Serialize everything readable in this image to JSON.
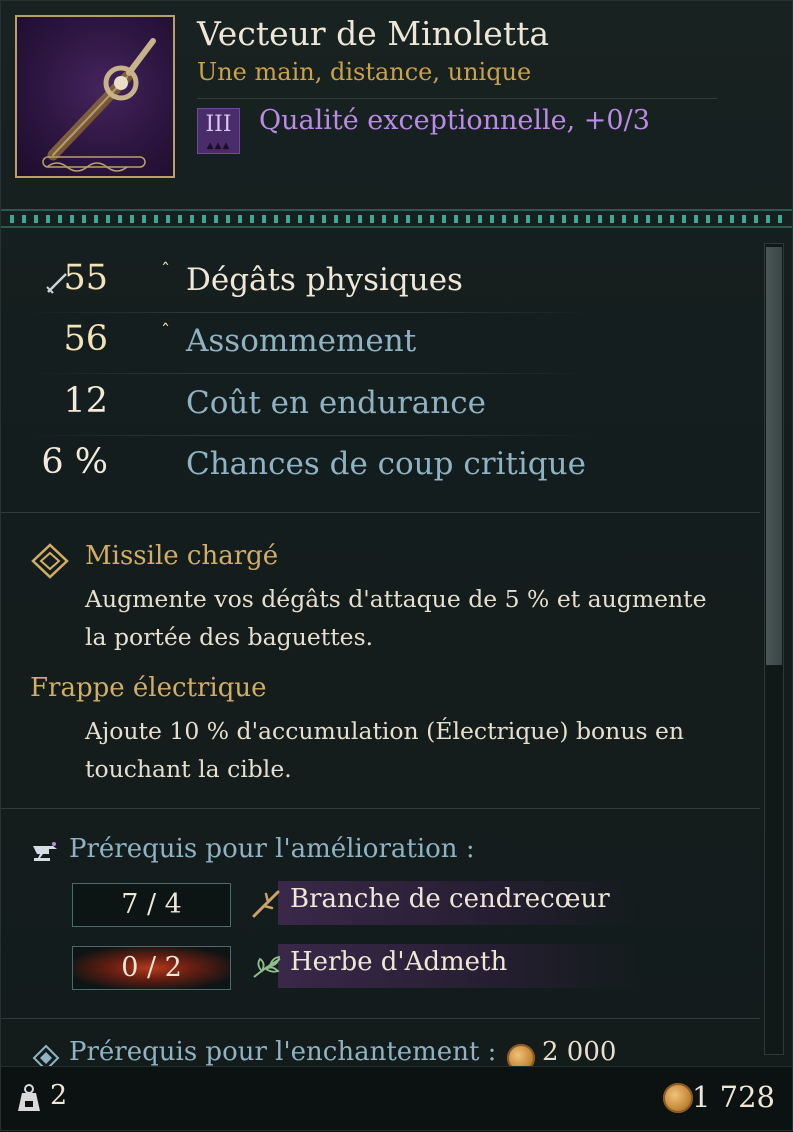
{
  "item": {
    "name": "Vecteur de Minoletta",
    "type_line": "Une main, distance, unique",
    "tier_numeral": "III",
    "quality_text": "Qualité exceptionnelle, +0/3"
  },
  "stats": [
    {
      "value": "55",
      "upgraded": true,
      "label": "Dégâts physiques",
      "primary": true,
      "icon": "sword-icon"
    },
    {
      "value": "56",
      "upgraded": true,
      "label": "Assommement",
      "primary": false
    },
    {
      "value": "12",
      "upgraded": false,
      "label": "Coût en endurance",
      "primary": false
    },
    {
      "value": "6 %",
      "upgraded": false,
      "label": "Chances de coup critique",
      "primary": false
    }
  ],
  "perks": [
    {
      "icon": "diamond-icon",
      "title": "Missile chargé",
      "description": "Augmente vos dégâts d'attaque de 5 % et augmente la portée des baguettes."
    },
    {
      "title": "Frappe électrique",
      "description": "Ajoute 10 % d'accumulation (Électrique) bonus en touchant la cible."
    }
  ],
  "upgrade": {
    "icon": "anvil-icon",
    "title": "Prérequis pour l'amélioration :",
    "requirements": [
      {
        "count": "7 / 4",
        "met": true,
        "resource": "Branche de cendrecœur",
        "icon": "branch-icon"
      },
      {
        "count": "0 / 2",
        "met": false,
        "resource": "Herbe d'Admeth",
        "icon": "herb-icon"
      }
    ]
  },
  "enchant": {
    "icon": "enchant-icon",
    "title": "Prérequis pour l'enchantement :",
    "cost": "2 000",
    "cost_icon": "coin-icon"
  },
  "footer": {
    "weight": "2",
    "weight_icon": "weight-icon",
    "money": "1 728",
    "money_icon": "coin-icon"
  },
  "colors": {
    "accent_gold": "#c9a24b",
    "quality_purple": "#b98ae6",
    "secondary_stat": "#8fb3c3",
    "ornament_teal": "#3aa893"
  }
}
